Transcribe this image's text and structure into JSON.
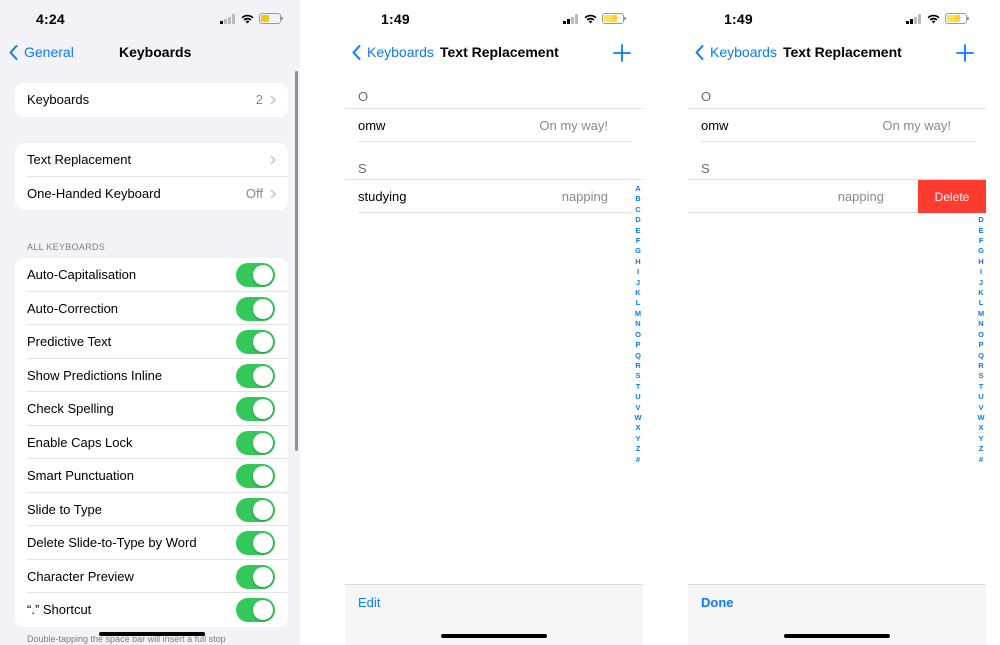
{
  "panel1": {
    "status": {
      "time": "4:24"
    },
    "nav": {
      "back_label": "General",
      "title": "Keyboards"
    },
    "keyboards_row": {
      "label": "Keyboards",
      "value": "2"
    },
    "group2": [
      {
        "label": "Text Replacement",
        "value": ""
      },
      {
        "label": "One-Handed Keyboard",
        "value": "Off"
      }
    ],
    "section_header": "ALL KEYBOARDS",
    "toggles": [
      {
        "label": "Auto-Capitalisation",
        "on": true
      },
      {
        "label": "Auto-Correction",
        "on": true
      },
      {
        "label": "Predictive Text",
        "on": true
      },
      {
        "label": "Show Predictions Inline",
        "on": true
      },
      {
        "label": "Check Spelling",
        "on": true
      },
      {
        "label": "Enable Caps Lock",
        "on": true
      },
      {
        "label": "Smart Punctuation",
        "on": true
      },
      {
        "label": "Slide to Type",
        "on": true
      },
      {
        "label": "Delete Slide-to-Type by Word",
        "on": true
      },
      {
        "label": "Character Preview",
        "on": true
      },
      {
        "label": "“.” Shortcut",
        "on": true
      }
    ],
    "footer": "Double-tapping the space bar will insert a full stop"
  },
  "panel2": {
    "status": {
      "time": "1:49"
    },
    "nav": {
      "back_label": "Keyboards",
      "title": "Text Replacement"
    },
    "sections": [
      {
        "letter": "O",
        "items": [
          {
            "phrase": "omw",
            "shortcut": "On my way!"
          }
        ]
      },
      {
        "letter": "S",
        "items": [
          {
            "phrase": "studying",
            "shortcut": "napping"
          }
        ]
      }
    ],
    "bottom_button": "Edit"
  },
  "panel3": {
    "status": {
      "time": "1:49"
    },
    "nav": {
      "back_label": "Keyboards",
      "title": "Text Replacement"
    },
    "sections": [
      {
        "letter": "O",
        "items": [
          {
            "phrase": "omw",
            "shortcut": "On my way!"
          }
        ]
      },
      {
        "letter": "S",
        "items": [
          {
            "phrase": "",
            "shortcut": "napping"
          }
        ]
      }
    ],
    "delete_label": "Delete",
    "bottom_button": "Done"
  },
  "index_letters": [
    "A",
    "B",
    "C",
    "D",
    "E",
    "F",
    "G",
    "H",
    "I",
    "J",
    "K",
    "L",
    "M",
    "N",
    "O",
    "P",
    "Q",
    "R",
    "S",
    "T",
    "U",
    "V",
    "W",
    "X",
    "Y",
    "Z",
    "#"
  ],
  "colors": {
    "accent": "#0a7aff",
    "switch_on": "#34c759",
    "delete": "#ff3b30",
    "grouped_bg": "#f2f2f7"
  },
  "icons": {
    "signal": "cellular-signal-icon",
    "wifi": "wifi-icon",
    "battery": "battery-icon",
    "back": "chevron-left-icon",
    "add": "plus-icon",
    "disclosure": "chevron-right-icon"
  }
}
